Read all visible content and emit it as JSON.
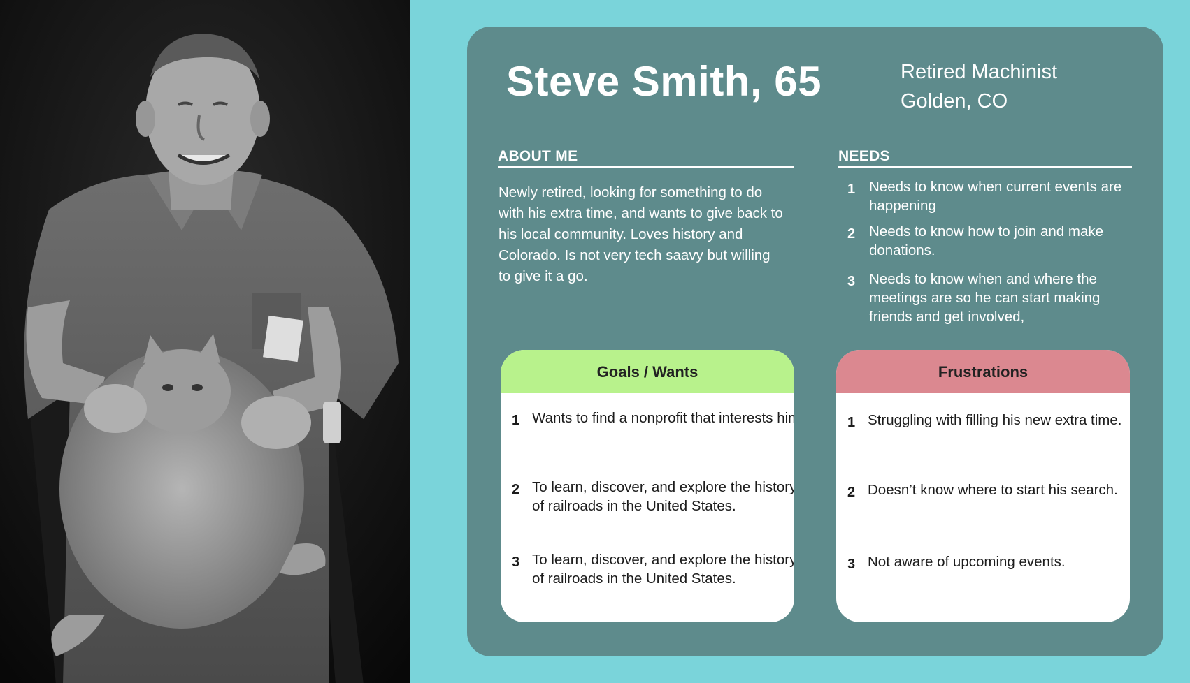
{
  "persona": {
    "name": "Steve Smith, 65",
    "role": "Retired Machinist",
    "location": "Golden, CO"
  },
  "about": {
    "heading": "ABOUT ME",
    "text": "Newly retired, looking for something to do with his extra time, and wants to give back to his local community. Loves history and Colorado. Is not very tech saavy but willing to give it a go."
  },
  "needs": {
    "heading": "NEEDS",
    "items": [
      {
        "num": "1",
        "text": "Needs to know when current events are happening"
      },
      {
        "num": "2",
        "text": "Needs to know how to join and make donations."
      },
      {
        "num": "3",
        "text": "Needs to know when and where the meetings are so he can start making friends and get involved,"
      }
    ]
  },
  "goals": {
    "heading": "Goals / Wants",
    "items": [
      {
        "num": "1",
        "text": "Wants to find a nonprofit that interests him."
      },
      {
        "num": "2",
        "text": "To learn, discover, and explore the history of railroads in the United States."
      },
      {
        "num": "3",
        "text": "To learn, discover, and explore the history of railroads in the United States."
      }
    ]
  },
  "frustrations": {
    "heading": "Frustrations",
    "items": [
      {
        "num": "1",
        "text": "Struggling with filling his new extra time."
      },
      {
        "num": "2",
        "text": "Doesn’t know where to start his search."
      },
      {
        "num": "3",
        "text": "Not aware of upcoming events."
      }
    ]
  },
  "colors": {
    "page_bg": "#7ad4da",
    "card_bg": "#5e8b8c",
    "goals_header": "#b8f28c",
    "frustrations_header": "#db8890"
  },
  "photo": {
    "icon": "persona-photo"
  }
}
